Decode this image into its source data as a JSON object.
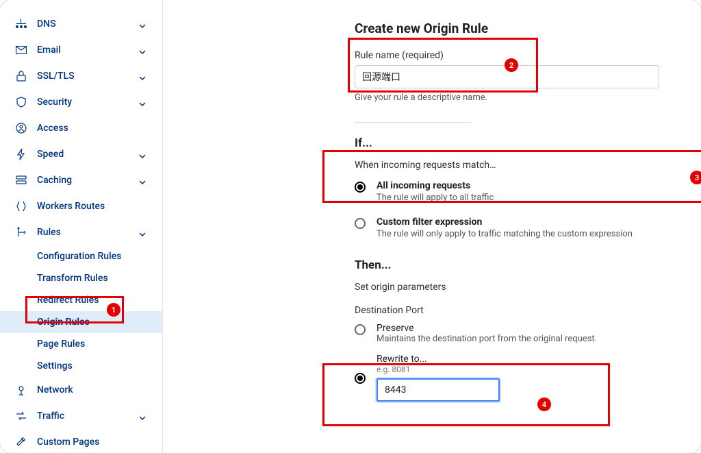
{
  "sidebar": {
    "items": [
      {
        "label": "DNS",
        "icon": "dns",
        "expandable": true
      },
      {
        "label": "Email",
        "icon": "email",
        "expandable": true
      },
      {
        "label": "SSL/TLS",
        "icon": "lock",
        "expandable": true
      },
      {
        "label": "Security",
        "icon": "shield",
        "expandable": true
      },
      {
        "label": "Access",
        "icon": "access",
        "expandable": false
      },
      {
        "label": "Speed",
        "icon": "bolt",
        "expandable": true
      },
      {
        "label": "Caching",
        "icon": "cache",
        "expandable": true
      },
      {
        "label": "Workers Routes",
        "icon": "workers",
        "expandable": false
      },
      {
        "label": "Rules",
        "icon": "rules",
        "expandable": true,
        "expanded": true,
        "subitems": [
          {
            "label": "Configuration Rules"
          },
          {
            "label": "Transform Rules"
          },
          {
            "label": "Redirect Rules"
          },
          {
            "label": "Origin Rules",
            "active": true
          },
          {
            "label": "Page Rules"
          },
          {
            "label": "Settings"
          }
        ]
      },
      {
        "label": "Network",
        "icon": "network",
        "expandable": false
      },
      {
        "label": "Traffic",
        "icon": "traffic",
        "expandable": true
      },
      {
        "label": "Custom Pages",
        "icon": "wrench",
        "expandable": false
      }
    ]
  },
  "main": {
    "title": "Create new Origin Rule",
    "rule_name_label": "Rule name (required)",
    "rule_name_value": "回源端口",
    "rule_name_hint": "Give your rule a descriptive name.",
    "if_heading": "If...",
    "if_subheading": "When incoming requests match…",
    "radio_all_title": "All incoming requests",
    "radio_all_desc": "The rule will apply to all traffic",
    "radio_custom_title": "Custom filter expression",
    "radio_custom_desc": "The rule will only apply to traffic matching the custom expression",
    "then_heading": "Then...",
    "then_sub": "Set origin parameters",
    "dest_port_label": "Destination Port",
    "preserve_label": "Preserve",
    "preserve_desc": "Maintains the destination port from the original request.",
    "rewrite_label": "Rewrite to...",
    "rewrite_example": "e.g. 8081",
    "rewrite_value": "8443"
  },
  "badges": {
    "b1": "1",
    "b2": "2",
    "b3": "3",
    "b4": "4"
  }
}
